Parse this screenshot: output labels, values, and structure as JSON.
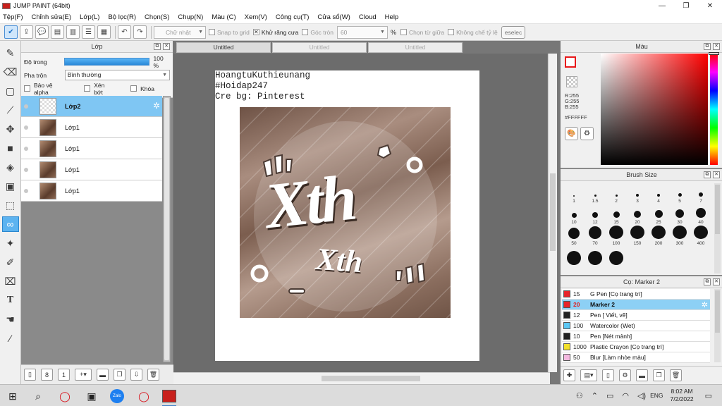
{
  "window": {
    "title": "JUMP PAINT (64bit)",
    "minimize": "—",
    "maximize": "❐",
    "close": "✕"
  },
  "menu": [
    "Tệp(F)",
    "Chỉnh sửa(E)",
    "Lớp(L)",
    "Bộ lọc(R)",
    "Chọn(S)",
    "Chụp(N)",
    "Màu (C)",
    "Xem(V)",
    "Công cụ(T)",
    "Cửa sổ(W)",
    "Cloud",
    "Help"
  ],
  "toolbar": {
    "shape_select": "Chữ nhật",
    "snap_to_grid": "Snap to grid",
    "antialias": "Khử răng cưa",
    "round_corner": "Góc tròn",
    "round_value": "60",
    "percent": "%",
    "select_from_center": "Chọn từ giữa",
    "no_ratio": "Không chế tỷ lệ",
    "deselect": "eselec"
  },
  "layer_panel": {
    "title": "Lớp",
    "opacity_label": "Độ trong",
    "opacity_value": "100 %",
    "blend_label": "Pha trộn",
    "blend_value": "Bình thường",
    "alpha_protect": "Bảo vệ alpha",
    "clipping": "Xén bớt",
    "lock": "Khóa",
    "layers": [
      {
        "name": "Lớp2",
        "active": true,
        "thumb": "transparent"
      },
      {
        "name": "Lớp1",
        "active": false,
        "thumb": "photo"
      },
      {
        "name": "Lớp1",
        "active": false,
        "thumb": "photo"
      },
      {
        "name": "Lớp1",
        "active": false,
        "thumb": "photo"
      },
      {
        "name": "Lớp1",
        "active": false,
        "thumb": "photo"
      }
    ]
  },
  "document_tabs": [
    "Untitled",
    "Untitled",
    "Untitled"
  ],
  "canvas": {
    "lines": [
      "HoangtuKuthieunang",
      "#Hoidap247",
      "Cre bg: Pinterest"
    ],
    "art_big": "Xth",
    "art_small": "Xth"
  },
  "color_panel": {
    "title": "Màu",
    "r": "R:255",
    "g": "G:255",
    "b": "B:255",
    "hex": "#FFFFFF",
    "hue_color": "#ff0000"
  },
  "brush_panel": {
    "title": "Brush Size",
    "sizes": [
      "1",
      "1.5",
      "2",
      "3",
      "4",
      "5",
      "7",
      "10",
      "12",
      "15",
      "20",
      "25",
      "30",
      "40",
      "50",
      "70",
      "100",
      "150",
      "200",
      "300",
      "400",
      "",
      "",
      ""
    ]
  },
  "pen_panel": {
    "title": "Cọ: Marker 2",
    "pens": [
      {
        "size": "15",
        "name": "G Pen [Cọ trang trí]",
        "color": "#e8242a",
        "active": false
      },
      {
        "size": "20",
        "name": "Marker 2",
        "color": "#e8242a",
        "active": true
      },
      {
        "size": "12",
        "name": "Pen [ Viết, vẽ]",
        "color": "#222222",
        "active": false
      },
      {
        "size": "100",
        "name": "Watercolor (Wet)",
        "color": "#5cc8f5",
        "active": false
      },
      {
        "size": "10",
        "name": "Pen [Nét mảnh]",
        "color": "#222222",
        "active": false
      },
      {
        "size": "1000",
        "name": "Plastic Crayon [Cọ trang trí]",
        "color": "#f2e02a",
        "active": false
      },
      {
        "size": "50",
        "name": "Blur [Làm nhòe màu]",
        "color": "#f4b8e0",
        "active": false
      }
    ]
  },
  "taskbar": {
    "lang": "ENG",
    "time": "8:02 AM",
    "date": "7/2/2022",
    "zalo": "Zalo"
  }
}
